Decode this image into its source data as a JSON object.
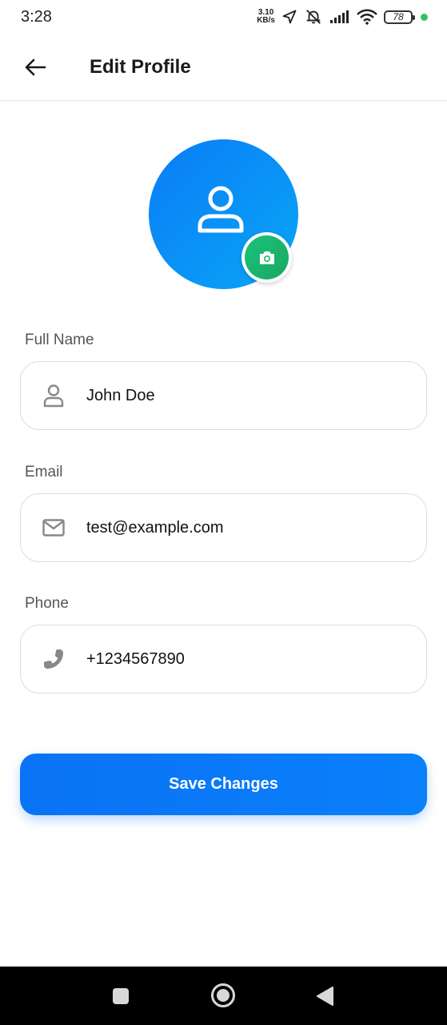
{
  "status_bar": {
    "time": "3:28",
    "net_speed_value": "3.10",
    "net_speed_unit": "KB/s",
    "battery_level": "78",
    "icons": [
      "location-arrow-icon",
      "bell-off-icon",
      "signal-icon",
      "wifi-icon",
      "battery-icon"
    ],
    "dot_color": "#2fc463"
  },
  "app_bar": {
    "title": "Edit Profile",
    "back_icon": "arrow-left-icon"
  },
  "avatar": {
    "placeholder_icon": "user-icon",
    "camera_icon": "camera-icon",
    "gradient_colors": [
      "#0a7cf7",
      "#09a6f6"
    ],
    "camera_color": "#1cc27a"
  },
  "form": {
    "full_name": {
      "label": "Full Name",
      "value": "John Doe",
      "icon": "user-outline-icon"
    },
    "email": {
      "label": "Email",
      "value": "test@example.com",
      "icon": "mail-icon"
    },
    "phone": {
      "label": "Phone",
      "value": "+1234567890",
      "icon": "phone-icon"
    }
  },
  "save_button": {
    "label": "Save Changes",
    "color": "#0a7af8"
  },
  "nav_bar": {
    "buttons": [
      "recents-square-icon",
      "home-circle-icon",
      "back-triangle-icon"
    ]
  }
}
